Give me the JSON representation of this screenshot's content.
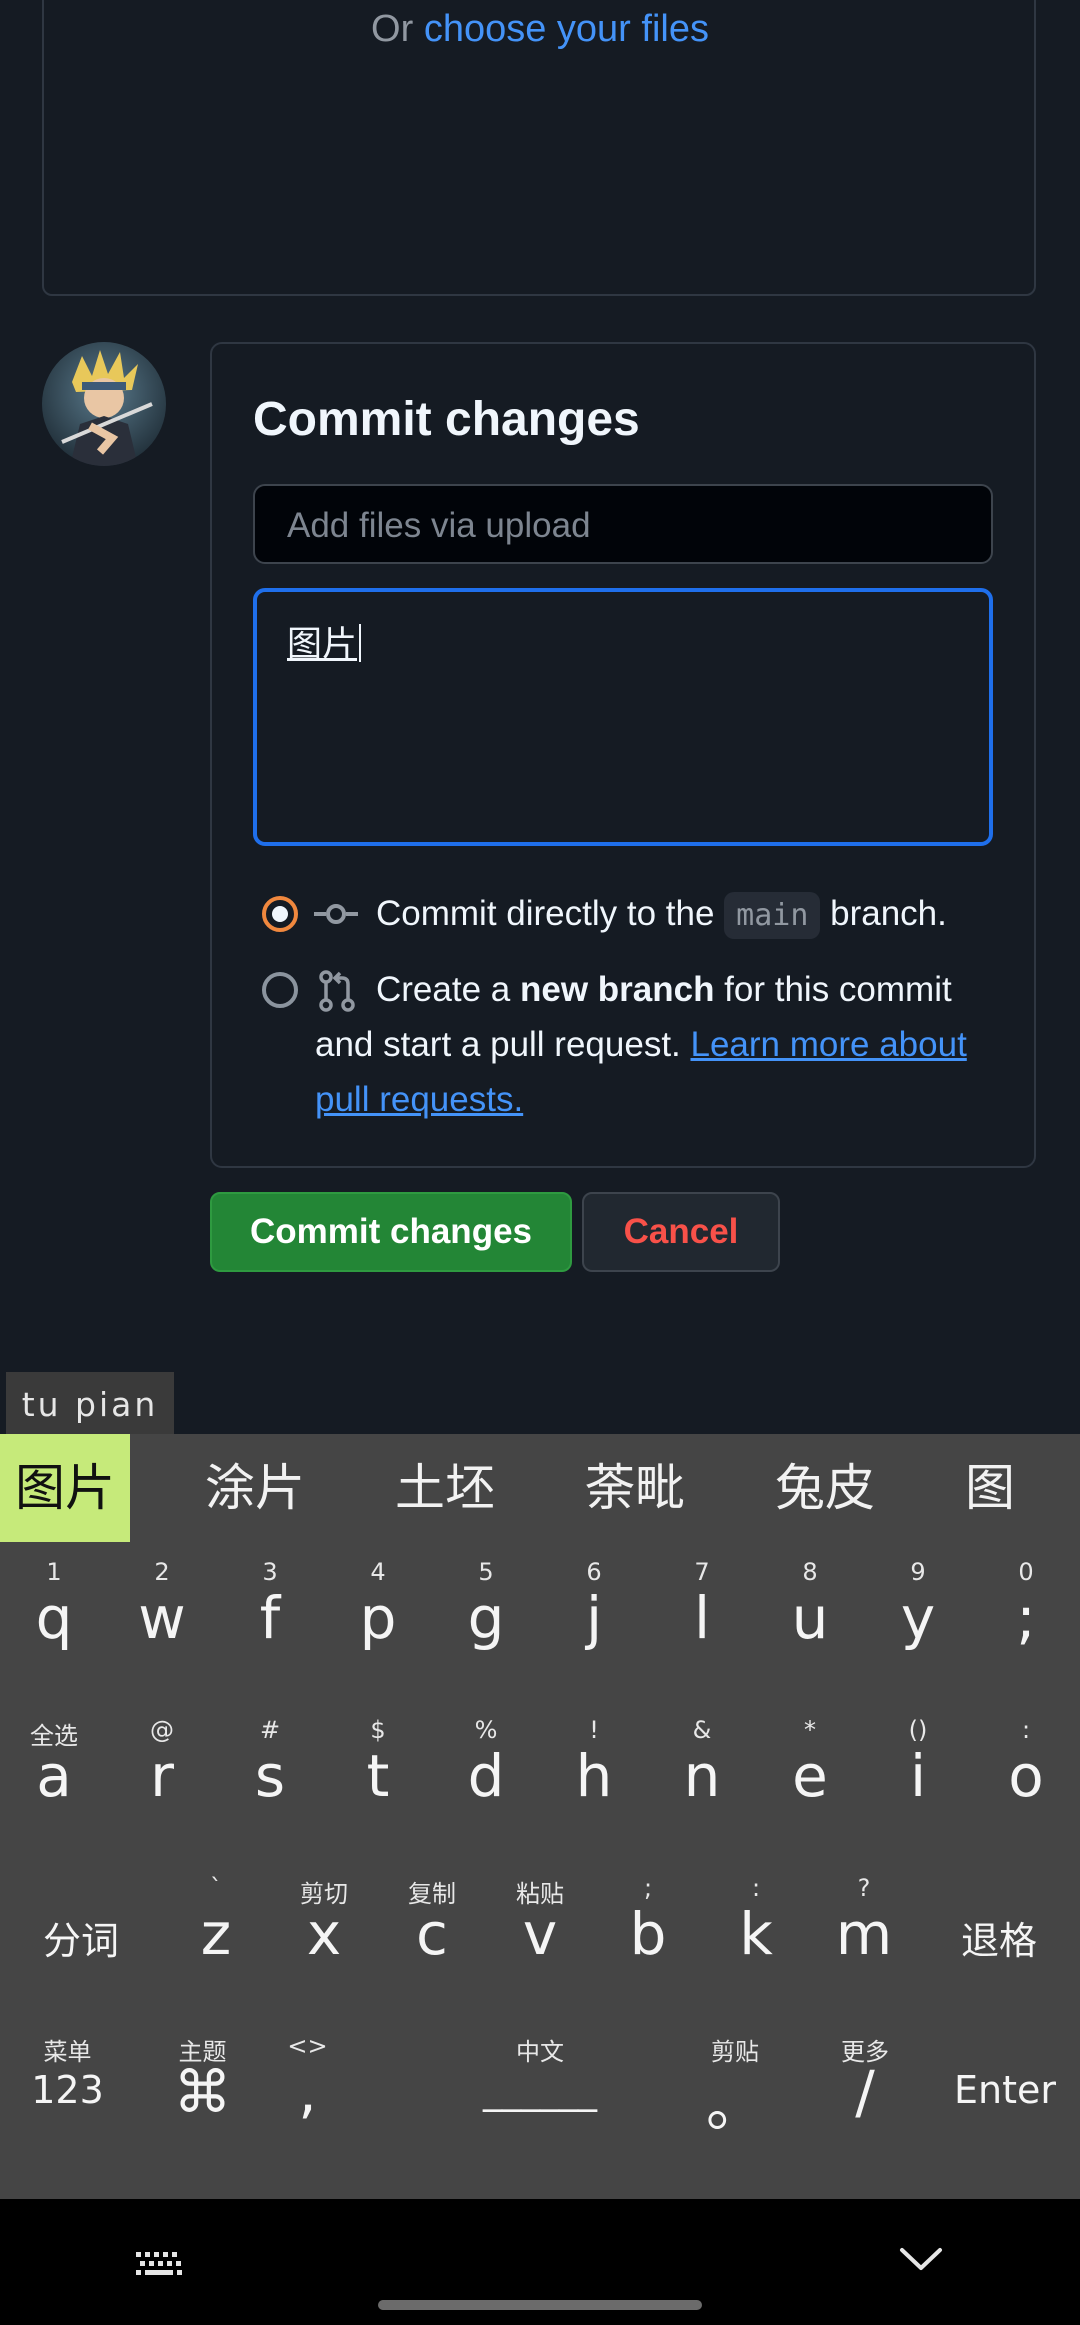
{
  "upload": {
    "or_text": "Or ",
    "choose_link": "choose your files"
  },
  "commit": {
    "title": "Commit changes",
    "summary_placeholder": "Add files via upload",
    "description_value": "图片",
    "option_direct": {
      "before": "Commit directly to the ",
      "branch": "main",
      "after": " branch."
    },
    "option_new": {
      "before": "Create a ",
      "bold": "new branch",
      "after": " for this commit and start a pull request. ",
      "link": "Learn more about pull requests."
    },
    "commit_button": "Commit changes",
    "cancel_button": "Cancel",
    "colors": {
      "commit_green": "#238636",
      "cancel_red": "#f85149",
      "link_blue": "#4493f8",
      "focus_blue": "#1f6feb",
      "radio_orange": "#f0883e"
    }
  },
  "ime": {
    "pinyin": "tu pian",
    "candidates": [
      "图片",
      "涂片",
      "土坯",
      "荼毗",
      "兔皮",
      "图"
    ],
    "row1": [
      {
        "sup": "1",
        "key": "q"
      },
      {
        "sup": "2",
        "key": "w"
      },
      {
        "sup": "3",
        "key": "f"
      },
      {
        "sup": "4",
        "key": "p"
      },
      {
        "sup": "5",
        "key": "g"
      },
      {
        "sup": "6",
        "key": "j"
      },
      {
        "sup": "7",
        "key": "l"
      },
      {
        "sup": "8",
        "key": "u"
      },
      {
        "sup": "9",
        "key": "y"
      },
      {
        "sup": "0",
        "key": ";"
      }
    ],
    "row2": [
      {
        "sup": "全选",
        "key": "a"
      },
      {
        "sup": "@",
        "key": "r"
      },
      {
        "sup": "#",
        "key": "s"
      },
      {
        "sup": "$",
        "key": "t"
      },
      {
        "sup": "%",
        "key": "d"
      },
      {
        "sup": "!",
        "key": "h"
      },
      {
        "sup": "&",
        "key": "n"
      },
      {
        "sup": "*",
        "key": "e"
      },
      {
        "sup": "()",
        "key": "i"
      },
      {
        "sup": ":",
        "key": "o"
      }
    ],
    "row3": [
      {
        "sup": "",
        "key": "分词"
      },
      {
        "sup": "`",
        "key": "z"
      },
      {
        "sup": "剪切",
        "key": "x"
      },
      {
        "sup": "复制",
        "key": "c"
      },
      {
        "sup": "粘贴",
        "key": "v"
      },
      {
        "sup": ";",
        "key": "b"
      },
      {
        "sup": ":",
        "key": "k"
      },
      {
        "sup": "?",
        "key": "m"
      },
      {
        "sup": "",
        "key": "退格"
      }
    ],
    "row4": [
      {
        "sup": "菜单",
        "key": "123"
      },
      {
        "sup": "主题",
        "key": "⌘"
      },
      {
        "sup": "<>",
        "key": ","
      },
      {
        "sup": "中文",
        "key": "______"
      },
      {
        "sup": "剪贴",
        "key": "。"
      },
      {
        "sup": "更多",
        "key": "/"
      },
      {
        "sup": "",
        "key": "Enter"
      }
    ]
  }
}
